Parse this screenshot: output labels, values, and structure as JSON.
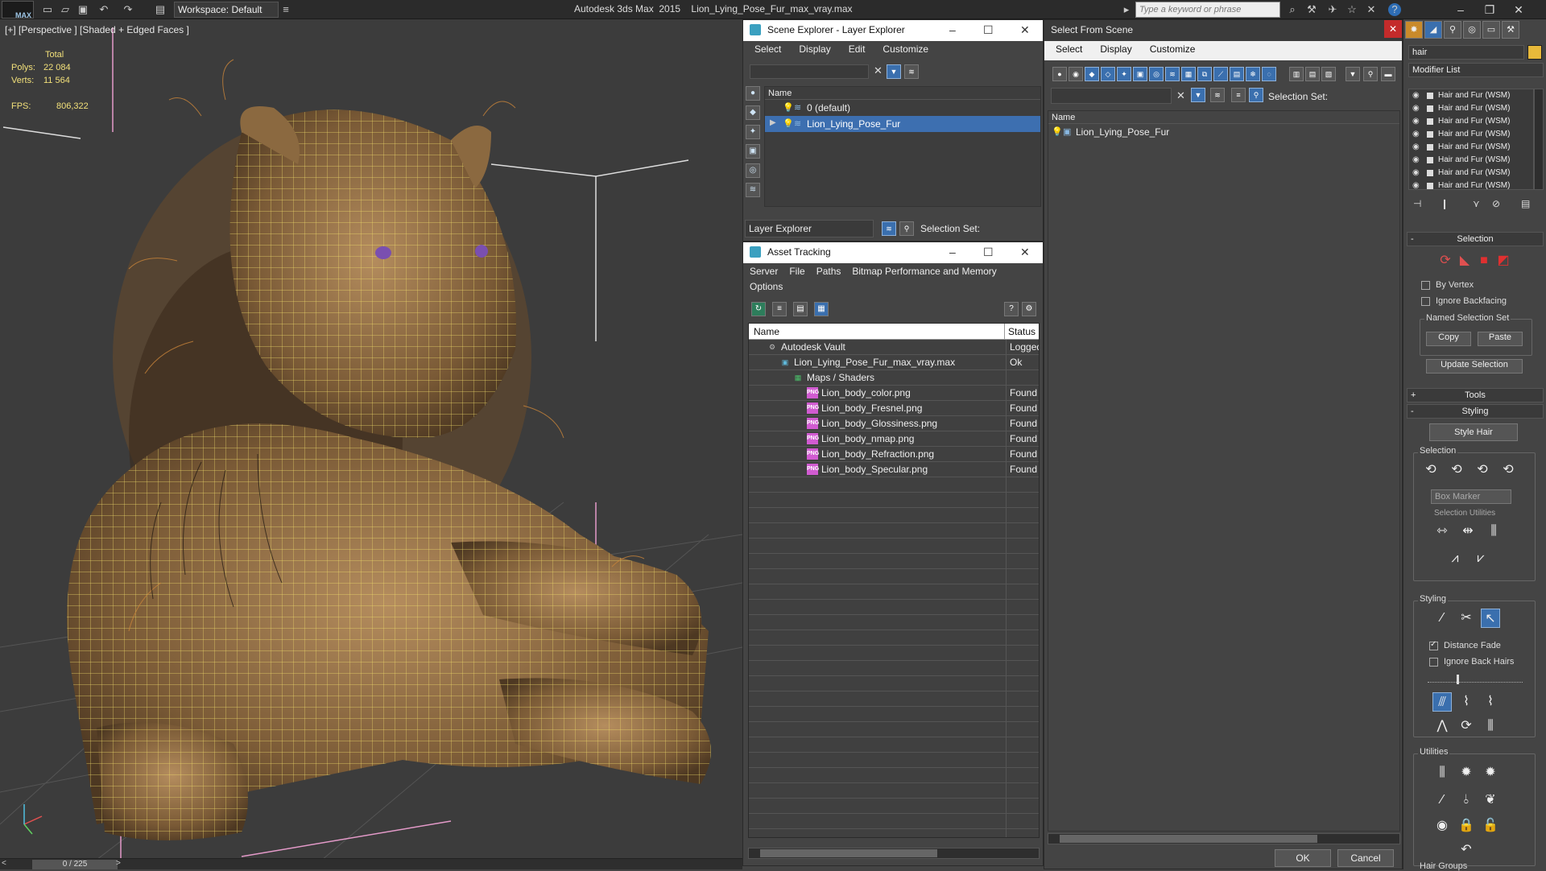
{
  "titlebar": {
    "app_logo": "MAX",
    "workspace": "Workspace: Default",
    "title": "Autodesk 3ds Max  2015    Lion_Lying_Pose_Fur_max_vray.max",
    "search_placeholder": "Type a keyword or phrase"
  },
  "viewport": {
    "label": "[+] [Perspective ] [Shaded + Edged Faces ]",
    "stats": {
      "total_label": "Total",
      "polys_label": "Polys:",
      "polys": "22 084",
      "verts_label": "Verts:",
      "verts": "11 564",
      "fps_label": "FPS:",
      "fps": "806,322"
    },
    "timeslider": "0 / 225"
  },
  "scene_explorer": {
    "title": "Scene Explorer - Layer Explorer",
    "menu": [
      "Select",
      "Display",
      "Edit",
      "Customize"
    ],
    "col_name": "Name",
    "rows": [
      {
        "label": "0 (default)",
        "selected": false
      },
      {
        "label": "Lion_Lying_Pose_Fur",
        "selected": true
      }
    ],
    "footer_dropdown": "Layer Explorer",
    "selection_set_label": "Selection Set:"
  },
  "asset_tracking": {
    "title": "Asset Tracking",
    "menu": [
      "Server",
      "File",
      "Paths",
      "Bitmap Performance and Memory"
    ],
    "menu_row2": [
      "Options"
    ],
    "col_name": "Name",
    "col_status": "Status",
    "rows": [
      {
        "name": "Autodesk Vault",
        "status": "Logged",
        "level": 0,
        "icon": "vault-icon"
      },
      {
        "name": "Lion_Lying_Pose_Fur_max_vray.max",
        "status": "Ok",
        "level": 1,
        "icon": "max-file-icon"
      },
      {
        "name": "Maps / Shaders",
        "status": "",
        "level": 2,
        "icon": "maps-icon"
      },
      {
        "name": "Lion_body_color.png",
        "status": "Found",
        "level": 3,
        "icon": "png-icon"
      },
      {
        "name": "Lion_body_Fresnel.png",
        "status": "Found",
        "level": 3,
        "icon": "png-icon"
      },
      {
        "name": "Lion_body_Glossiness.png",
        "status": "Found",
        "level": 3,
        "icon": "png-icon"
      },
      {
        "name": "Lion_body_nmap.png",
        "status": "Found",
        "level": 3,
        "icon": "png-icon"
      },
      {
        "name": "Lion_body_Refraction.png",
        "status": "Found",
        "level": 3,
        "icon": "png-icon"
      },
      {
        "name": "Lion_body_Specular.png",
        "status": "Found",
        "level": 3,
        "icon": "png-icon"
      }
    ]
  },
  "select_from_scene": {
    "title": "Select From Scene",
    "menu": [
      "Select",
      "Display",
      "Customize"
    ],
    "selection_set_label": "Selection Set:",
    "col_name": "Name",
    "rows": [
      "Lion_Lying_Pose_Fur"
    ],
    "ok": "OK",
    "cancel": "Cancel"
  },
  "command_panel": {
    "object_name": "hair",
    "object_color": "#e8b93a",
    "modifier_list": "Modifier List",
    "stack": [
      "Hair and Fur (WSM)",
      "Hair and Fur (WSM)",
      "Hair and Fur (WSM)",
      "Hair and Fur (WSM)",
      "Hair and Fur (WSM)",
      "Hair and Fur (WSM)",
      "Hair and Fur (WSM)",
      "Hair and Fur (WSM)"
    ],
    "selection_rollout": "Selection",
    "by_vertex": "By Vertex",
    "ignore_backfacing": "Ignore Backfacing",
    "named_selection_set": "Named Selection Set",
    "copy": "Copy",
    "paste": "Paste",
    "update_selection": "Update Selection",
    "tools_rollout": "Tools",
    "styling_rollout": "Styling",
    "style_hair": "Style Hair",
    "selection_group": "Selection",
    "box_marker": "Box Marker",
    "selection_utilities": "Selection Utilities",
    "styling_group": "Styling",
    "distance_fade": "Distance Fade",
    "ignore_back_hairs": "Ignore Back Hairs",
    "utilities_group": "Utilities",
    "hair_groups": "Hair Groups"
  },
  "colors": {
    "accent": "#3d6fb0",
    "stats_text": "#f2e07a",
    "close_red": "#c42b2b"
  }
}
